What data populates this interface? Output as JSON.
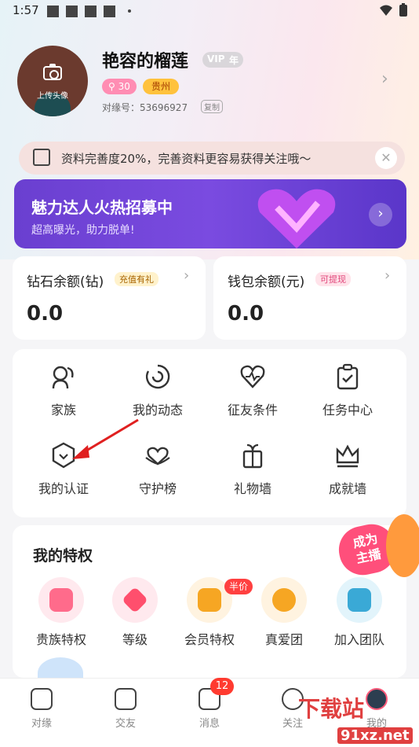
{
  "status_bar": {
    "time": "1:57",
    "dot": "•"
  },
  "profile": {
    "name": "艳容的榴莲",
    "vip_label": "VIP",
    "vip_suffix": "年",
    "avatar_upload": "上传头像",
    "level": "30",
    "level_icon": "search-icon",
    "location": "贵州",
    "uid": "对缘号：53696927",
    "copy_label": "复制"
  },
  "tip": {
    "text": "资料完善度20%，完善资料更容易获得关注哦～",
    "close": "✕"
  },
  "banner": {
    "title": "魅力达人火热招募中",
    "subtitle": "超高曝光，助力脱单!",
    "arrow": "›"
  },
  "balances": [
    {
      "label": "钻石余额(钻)",
      "tag": "充值有礼",
      "value": "0.0",
      "tag_color": "#fff2cc",
      "tag_text_color": "#a86400"
    },
    {
      "label": "钱包余额(元)",
      "tag": "可提现",
      "value": "0.0",
      "tag_color": "#ffe3ea",
      "tag_text_color": "#e0457a"
    }
  ],
  "grid": [
    {
      "label": "家族",
      "icon": "family-icon"
    },
    {
      "label": "我的动态",
      "icon": "moments-icon"
    },
    {
      "label": "征友条件",
      "icon": "heart-pulse-icon"
    },
    {
      "label": "任务中心",
      "icon": "task-clipboard-icon"
    },
    {
      "label": "我的认证",
      "icon": "shield-check-icon"
    },
    {
      "label": "守护榜",
      "icon": "guard-heart-icon"
    },
    {
      "label": "礼物墙",
      "icon": "gift-icon"
    },
    {
      "label": "成就墙",
      "icon": "crown-icon"
    }
  ],
  "privileges": {
    "title": "我的特权",
    "become_host": "成为\n主播",
    "items": [
      {
        "label": "贵族特权",
        "icon": "noble-icon",
        "bg": "#ffe9ee",
        "fg": "#ff6b8b"
      },
      {
        "label": "等级",
        "icon": "diamond-icon",
        "bg": "#ffe9ee",
        "fg": "#ff4f6d"
      },
      {
        "label": "会员特权",
        "icon": "vip-shield-icon",
        "bg": "#fff3e0",
        "fg": "#f6a623",
        "badge": "半价"
      },
      {
        "label": "真爱团",
        "icon": "love-group-icon",
        "bg": "#fff3e0",
        "fg": "#f6a623"
      },
      {
        "label": "加入团队",
        "icon": "team-icon",
        "bg": "#e2f4fb",
        "fg": "#3aa9d6"
      }
    ]
  },
  "nav": {
    "items": [
      {
        "label": "对缘",
        "icon": "home-icon"
      },
      {
        "label": "交友",
        "icon": "video-icon"
      },
      {
        "label": "消息",
        "icon": "message-icon"
      },
      {
        "label": "关注",
        "icon": "heart-icon"
      },
      {
        "label": "我的",
        "icon": "avatar-icon"
      }
    ],
    "unread": "12"
  },
  "watermark": {
    "text": "下载站",
    "site": "91xz.net"
  }
}
